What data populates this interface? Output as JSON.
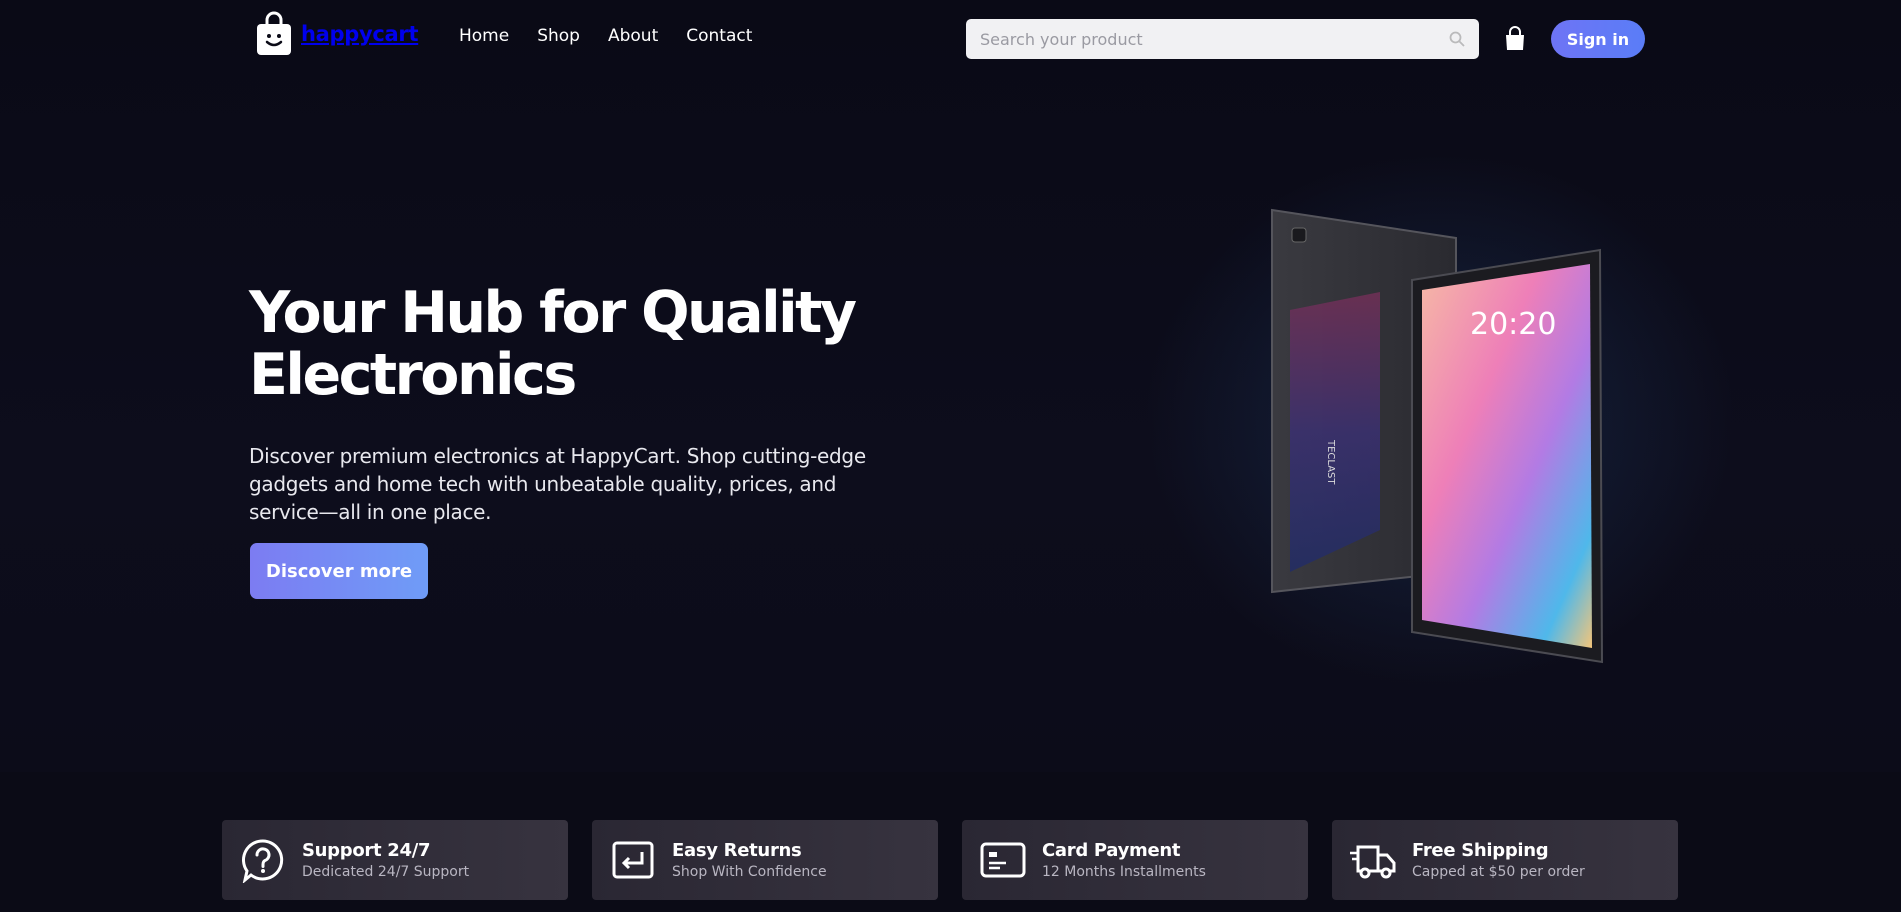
{
  "brand": {
    "name": "happycart"
  },
  "nav": {
    "items": [
      {
        "label": "Home"
      },
      {
        "label": "Shop"
      },
      {
        "label": "About"
      },
      {
        "label": "Contact"
      }
    ]
  },
  "search": {
    "placeholder": "Search your product",
    "value": ""
  },
  "header": {
    "signin_label": "Sign in"
  },
  "hero": {
    "title": "Your Hub for Quality Electronics",
    "description": "Discover premium electronics at HappyCart. Shop cutting-edge gadgets and home tech with unbeatable quality, prices, and service—all in one place.",
    "cta_label": "Discover more",
    "device_time": "20:20"
  },
  "features": [
    {
      "title": "Support 24/7",
      "subtitle": "Dedicated 24/7 Support",
      "icon": "question-icon"
    },
    {
      "title": "Easy Returns",
      "subtitle": "Shop With Confidence",
      "icon": "return-icon"
    },
    {
      "title": "Card Payment",
      "subtitle": "12 Months Installments",
      "icon": "credit-card-icon"
    },
    {
      "title": "Free Shipping",
      "subtitle": "Capped at $50 per order",
      "icon": "truck-icon"
    }
  ],
  "colors": {
    "background": "#0b0b17",
    "accent_start": "#6e74f5",
    "accent_end": "#5a7df7",
    "feature_card": "#2f2c38"
  }
}
